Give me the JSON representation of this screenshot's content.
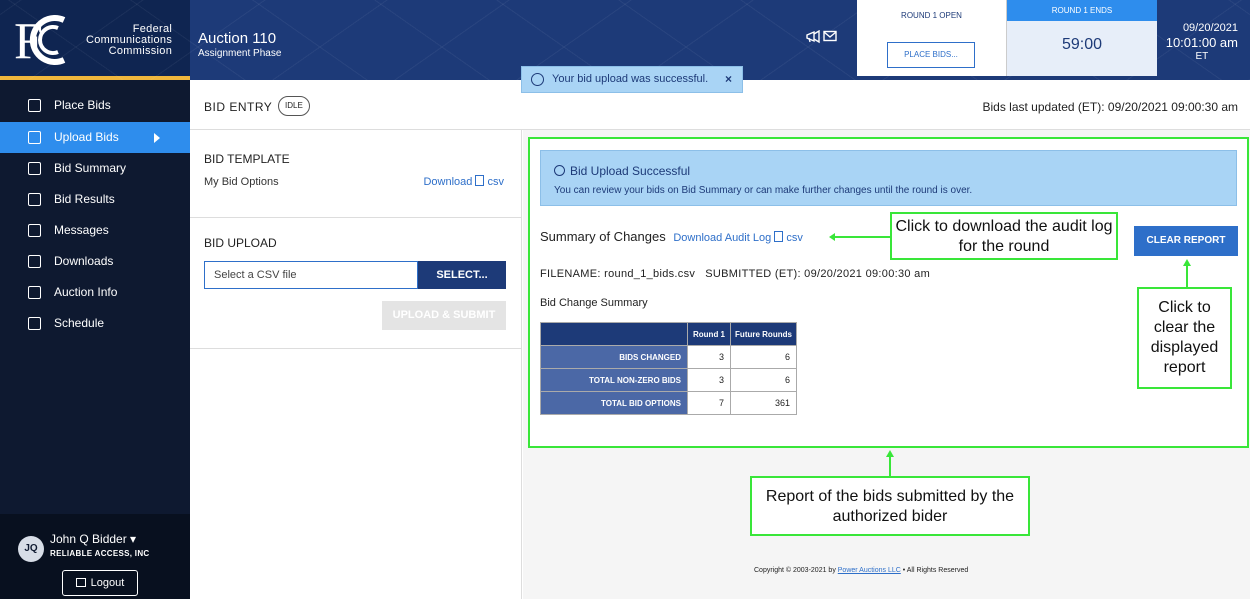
{
  "header": {
    "agency_lines": [
      "Federal",
      "Communications",
      "Commission"
    ],
    "auction_title": "Auction 110",
    "auction_phase": "Assignment Phase",
    "round_status": "ROUND 1 OPEN",
    "place_bids_button": "PLACE BIDS...",
    "round_ends_label": "ROUND 1 ENDS",
    "round_timer": "59:00",
    "date": "09/20/2021",
    "time": "10:01:00 am",
    "timezone": "ET"
  },
  "toast": {
    "message": "Your bid upload was successful.",
    "close": "×"
  },
  "sidebar": {
    "items": [
      {
        "label": "Place Bids",
        "icon": "gavel-icon"
      },
      {
        "label": "Upload Bids",
        "icon": "upload-file-icon",
        "active": true
      },
      {
        "label": "Bid Summary",
        "icon": "bid-summary-icon"
      },
      {
        "label": "Bid Results",
        "icon": "bid-results-icon"
      },
      {
        "label": "Messages",
        "icon": "mail-icon"
      },
      {
        "label": "Downloads",
        "icon": "download-icon"
      },
      {
        "label": "Auction Info",
        "icon": "info-doc-icon"
      },
      {
        "label": "Schedule",
        "icon": "calendar-icon"
      }
    ],
    "user": {
      "initials": "JQ",
      "name": "John Q Bidder ▾",
      "company": "RELIABLE ACCESS, INC",
      "logout": "Logout"
    }
  },
  "entry_bar": {
    "title": "BID ENTRY",
    "status": "IDLE",
    "updated": "Bids last updated (ET): 09/20/2021 09:00:30 am"
  },
  "bid_template": {
    "title": "BID TEMPLATE",
    "label": "My Bid Options",
    "download": "Download",
    "format": "csv"
  },
  "bid_upload": {
    "title": "BID UPLOAD",
    "placeholder": "Select a CSV file",
    "select_button": "SELECT...",
    "upload_button": "UPLOAD & SUBMIT"
  },
  "report": {
    "alert_title": "Bid Upload Successful",
    "alert_text": "You can review your bids on Bid Summary or can make further changes until the round is over.",
    "summary_title": "Summary of Changes",
    "download_audit": "Download Audit Log",
    "audit_format": "csv",
    "clear_button": "CLEAR REPORT",
    "filename_label": "FILENAME:",
    "filename": "round_1_bids.csv",
    "submitted_label": "SUBMITTED (ET):",
    "submitted": "09/20/2021 09:00:30 am",
    "bcs_title": "Bid Change Summary",
    "table": {
      "columns": [
        "Round 1",
        "Future Rounds"
      ],
      "rows": [
        {
          "label": "BIDS CHANGED",
          "values": [
            "3",
            "6"
          ]
        },
        {
          "label": "TOTAL NON-ZERO BIDS",
          "values": [
            "3",
            "6"
          ]
        },
        {
          "label": "TOTAL BID OPTIONS",
          "values": [
            "7",
            "361"
          ]
        }
      ]
    }
  },
  "annotations": {
    "audit_log": "Click to download the audit log for the round",
    "clear": "Click to clear the displayed report",
    "report": "Report of the bids submitted by the authorized bider"
  },
  "footer": {
    "prefix": "Copyright © 2003-2021 by ",
    "link": "Power Auctions LLC",
    "suffix": " • All Rights Reserved"
  },
  "colors": {
    "navy": "#1d3a78",
    "accent": "#2e8ded",
    "annotation_green": "#39e639"
  }
}
